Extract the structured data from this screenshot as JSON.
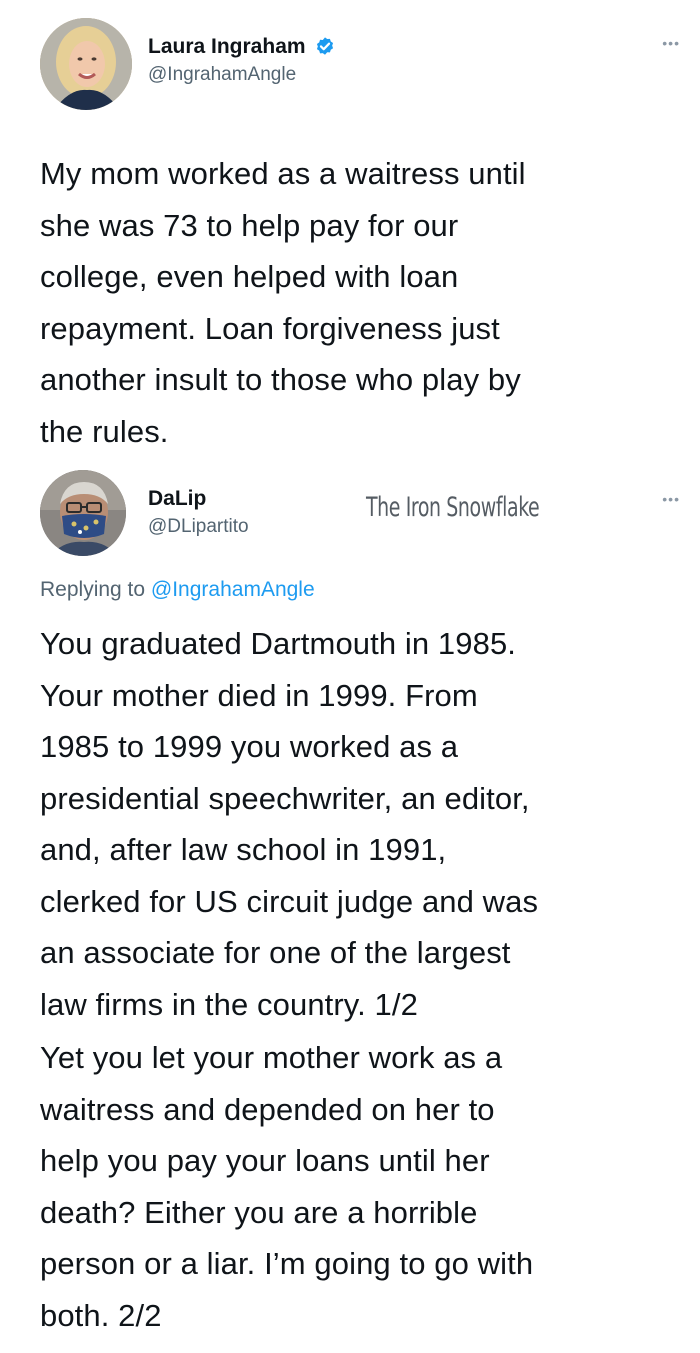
{
  "tweet1": {
    "author": {
      "name": "Laura Ingraham",
      "handle": "@IngrahamAngle",
      "verified": true,
      "avatar_icon": "avatar-photo-icon"
    },
    "more_icon": "more-options-icon",
    "text": "My mom worked as a waitress until\nshe was 73 to help pay for our\ncollege, even helped with loan\nrepayment. Loan forgiveness just\nanother insult to those who play by\nthe rules."
  },
  "tweet2": {
    "author": {
      "name": "DaLip",
      "handle": "@DLipartito",
      "avatar_icon": "avatar-photo-icon"
    },
    "watermark": "The Iron Snowflake",
    "more_icon": "more-options-icon",
    "replying_prefix": "Replying to ",
    "replying_to": "@IngrahamAngle",
    "text_part1": "You graduated Dartmouth in 1985.\nYour mother died in 1999. From\n1985 to 1999 you worked as a\npresidential speechwriter, an editor,\nand, after law school in 1991,\nclerked for US circuit judge and was\nan associate for one of the largest\nlaw firms in the country. 1/2",
    "text_part2": "Yet you let your mother work as a\nwaitress and depended on her to\nhelp you pay your loans until her\ndeath? Either you are a horrible\nperson or a liar. I’m going to go with\nboth. 2/2"
  },
  "colors": {
    "text": "#0f1419",
    "secondary": "#536471",
    "link": "#1d9bf0",
    "verified": "#1d9bf0"
  }
}
